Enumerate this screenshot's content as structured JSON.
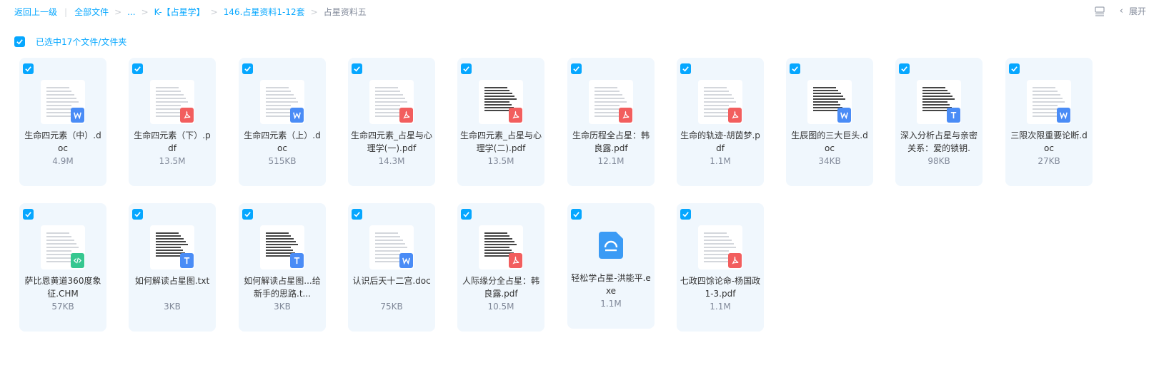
{
  "breadcrumb": {
    "back": "返回上一级",
    "all_files": "全部文件",
    "ellipsis": "...",
    "level1": "K-【占星学】",
    "level2": "146.占星资料1-12套",
    "current": "占星资料五"
  },
  "top_right": {
    "expand": "展开"
  },
  "selection": {
    "text": "已选中17个文件/文件夹"
  },
  "colors": {
    "accent": "#06a7ff",
    "pdf": "#f25e5e",
    "doc": "#4a8cf6",
    "chm": "#36c790"
  },
  "files": [
    {
      "name": "生命四元素（中）.doc",
      "size": "4.9M",
      "type": "doc",
      "icon": "word-icon"
    },
    {
      "name": "生命四元素（下）.pdf",
      "size": "13.5M",
      "type": "pdf",
      "icon": "pdf-icon"
    },
    {
      "name": "生命四元素（上）.doc",
      "size": "515KB",
      "type": "doc",
      "icon": "word-icon"
    },
    {
      "name": "生命四元素_占星与心理学(一).pdf",
      "size": "14.3M",
      "type": "pdf",
      "icon": "pdf-icon"
    },
    {
      "name": "生命四元素_占星与心理学(二).pdf",
      "size": "13.5M",
      "type": "pdf",
      "icon": "pdf-icon"
    },
    {
      "name": "生命历程全占星：韩良露.pdf",
      "size": "12.1M",
      "type": "pdf",
      "icon": "pdf-icon"
    },
    {
      "name": "生命的轨迹-胡茵梦.pdf",
      "size": "1.1M",
      "type": "pdf",
      "icon": "pdf-icon"
    },
    {
      "name": "生辰图的三大巨头.doc",
      "size": "34KB",
      "type": "doc",
      "icon": "word-icon"
    },
    {
      "name": "深入分析占星与亲密关系：爱的锁钥.",
      "size": "98KB",
      "type": "txt",
      "icon": "text-icon"
    },
    {
      "name": "三限次限重要论断.doc",
      "size": "27KB",
      "type": "doc",
      "icon": "word-icon"
    },
    {
      "name": "萨比恩黄道360度象征.CHM",
      "size": "57KB",
      "type": "chm",
      "icon": "code-icon"
    },
    {
      "name": "如何解读占星图.txt",
      "size": "3KB",
      "type": "txt",
      "icon": "text-icon"
    },
    {
      "name": "如何解读占星图...给新手的思路.t...",
      "size": "3KB",
      "type": "txt",
      "icon": "text-icon"
    },
    {
      "name": "认识后天十二宫.doc",
      "size": "75KB",
      "type": "doc",
      "icon": "word-icon"
    },
    {
      "name": "人际缘分全占星：韩良露.pdf",
      "size": "10.5M",
      "type": "pdf",
      "icon": "pdf-icon"
    },
    {
      "name": "轻松学占星-洪能平.exe",
      "size": "1.1M",
      "type": "exe",
      "icon": "exe-icon"
    },
    {
      "name": "七政四馀论命-杨国政1-3.pdf",
      "size": "1.1M",
      "type": "pdf",
      "icon": "pdf-icon"
    }
  ]
}
